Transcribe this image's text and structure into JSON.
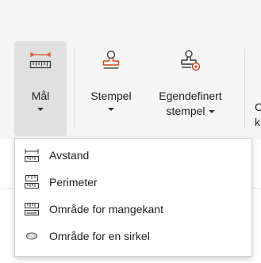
{
  "ribbon": {
    "measure": {
      "label": "Mål",
      "icon": "ruler-measure-icon",
      "accent": "#d44a1c"
    },
    "stamp": {
      "label": "Stempel",
      "icon": "stamp-icon",
      "accent": "#d44a1c"
    },
    "custom_stamp": {
      "label_line1": "Egendefinert",
      "label_line2": "stempel",
      "icon": "custom-stamp-icon",
      "accent": "#d44a1c"
    },
    "partial_next": {
      "line1": "C",
      "line2": "k"
    }
  },
  "dropdown": {
    "items": [
      {
        "label": "Avstand",
        "icon": "distance-icon"
      },
      {
        "label": "Perimeter",
        "icon": "perimeter-icon"
      },
      {
        "label": "Område for mangekant",
        "icon": "polygon-area-icon"
      },
      {
        "label": "Område for en sirkel",
        "icon": "circle-area-icon"
      }
    ]
  },
  "colors": {
    "accent": "#d44a1c",
    "icon_dark": "#333333",
    "ribbon_bg": "#f5f5f5",
    "active_bg": "#e0e0e0"
  }
}
